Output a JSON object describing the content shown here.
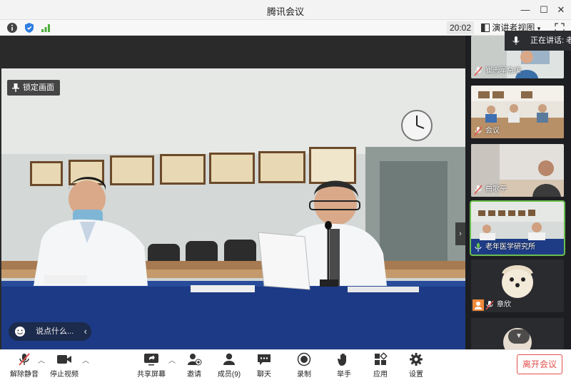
{
  "window": {
    "title": "腾讯会议"
  },
  "infobar": {
    "timer": "20:02",
    "view_mode": "演讲者视图",
    "speaking": "正在讲话: 老"
  },
  "main": {
    "lock_label": "锁定画面",
    "chat_placeholder": "说点什么..."
  },
  "participants": [
    {
      "name": "崔志军总编",
      "muted": true
    },
    {
      "name": "会议",
      "muted": true
    },
    {
      "name": "曲歌平",
      "muted": true
    },
    {
      "name": "老年医学研究所",
      "muted": false,
      "speaking": true
    },
    {
      "name": "章欣",
      "muted": true
    }
  ],
  "toolbar": {
    "unmute": "解除静音",
    "stop_video": "停止视频",
    "share_screen": "共享屏幕",
    "invite": "邀请",
    "members": "成员(9)",
    "chat": "聊天",
    "record": "录制",
    "raise_hand": "举手",
    "apps": "应用",
    "settings": "设置",
    "leave": "离开会议"
  },
  "colors": {
    "accent_green": "#6bbf4e",
    "leave_red": "#e2504b",
    "shield_blue": "#2f7de1"
  }
}
